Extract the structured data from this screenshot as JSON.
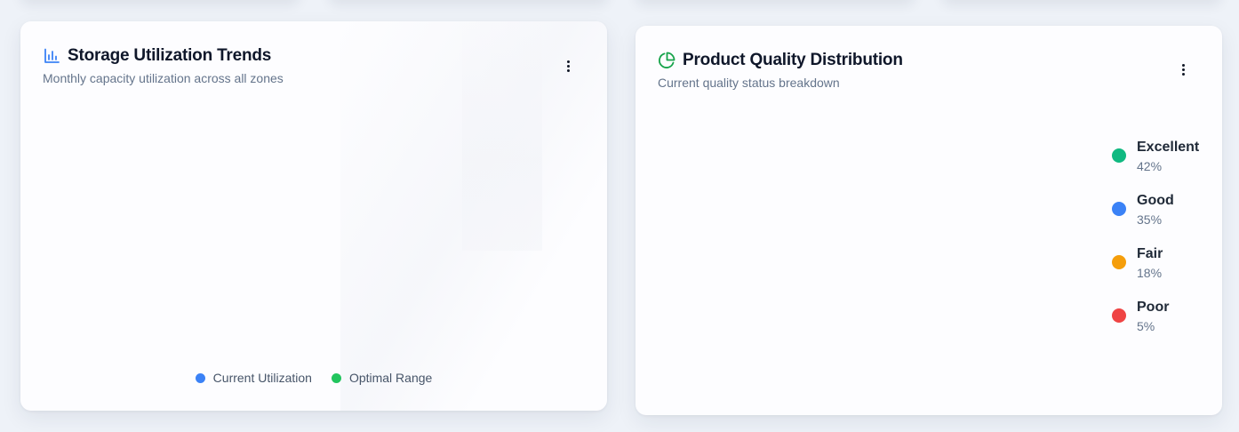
{
  "colors": {
    "accent_blue": "#3b82f6",
    "accent_green": "#22c55e",
    "quality_excellent": "#10b981",
    "quality_good": "#3b82f6",
    "quality_fair": "#f59e0b",
    "quality_poor": "#ef4444"
  },
  "storage_card": {
    "icon": "bar-chart-icon",
    "title": "Storage Utilization Trends",
    "subtitle": "Monthly capacity utilization across all zones",
    "legend": [
      {
        "label": "Current Utilization",
        "color": "#3b82f6"
      },
      {
        "label": "Optimal Range",
        "color": "#22c55e"
      }
    ]
  },
  "quality_card": {
    "icon": "pie-chart-icon",
    "title": "Product Quality Distribution",
    "subtitle": "Current quality status breakdown",
    "legend": [
      {
        "label": "Excellent",
        "percent": "42%",
        "color": "#10b981"
      },
      {
        "label": "Good",
        "percent": "35%",
        "color": "#3b82f6"
      },
      {
        "label": "Fair",
        "percent": "18%",
        "color": "#f59e0b"
      },
      {
        "label": "Poor",
        "percent": "5%",
        "color": "#ef4444"
      }
    ]
  }
}
